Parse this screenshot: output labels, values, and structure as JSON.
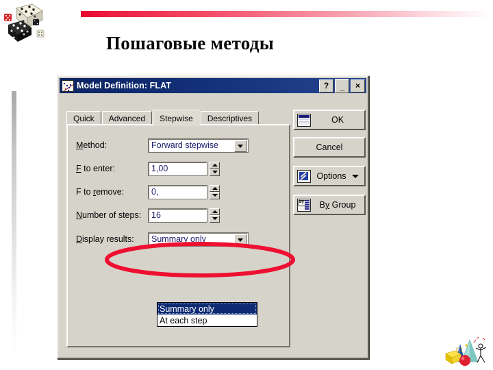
{
  "slide": {
    "title": "Пошаговые методы",
    "decorations": {
      "dice_art": "dice-clipart",
      "corner_art": "3d-shapes-clipart",
      "red_bar": "red-gradient-bar",
      "accent_color": "#e8072e"
    }
  },
  "dialog": {
    "title": "Model Definition: FLAT",
    "title_icon": "scatterplot-icon",
    "titlebar_color": "#0c2461",
    "caption_buttons": [
      {
        "name": "help-button",
        "label": "?"
      },
      {
        "name": "minimize-button",
        "label": "_"
      },
      {
        "name": "close-button",
        "label": "×"
      }
    ],
    "tabs": [
      {
        "label": "Quick",
        "active": false
      },
      {
        "label": "Advanced",
        "active": false
      },
      {
        "label": "Stepwise",
        "active": true
      },
      {
        "label": "Descriptives",
        "active": false
      }
    ],
    "fields": {
      "method": {
        "label_pre": "",
        "label_mnemonic": "M",
        "label_post": "ethod:",
        "value": "Forward stepwise",
        "control": "combobox"
      },
      "f_to_enter": {
        "label_pre": "",
        "label_mnemonic": "F",
        "label_post": " to enter:",
        "value": "1,00",
        "control": "spinner"
      },
      "f_to_remove": {
        "label_pre": "F to ",
        "label_mnemonic": "r",
        "label_post": "emove:",
        "value": "0,",
        "control": "spinner"
      },
      "number_of_steps": {
        "label_pre": "",
        "label_mnemonic": "N",
        "label_post": "umber of steps:",
        "value": "16",
        "control": "spinner"
      },
      "display_results": {
        "label_pre": "",
        "label_mnemonic": "D",
        "label_post": "isplay results:",
        "value": "Summary only",
        "control": "combobox",
        "open": true,
        "options": [
          {
            "label": "Summary only",
            "selected": true
          },
          {
            "label": "At each step",
            "selected": false
          }
        ]
      }
    },
    "buttons": [
      {
        "name": "ok-button",
        "label": "OK",
        "icon": "spreadsheet-icon",
        "dropdown": false
      },
      {
        "name": "cancel-button",
        "label": "Cancel",
        "icon": "",
        "dropdown": false
      },
      {
        "name": "options-button",
        "label": "Options",
        "icon": "tool-icon",
        "dropdown": true
      },
      {
        "name": "by-group-button",
        "label": "By Group",
        "icon": "by-group-icon",
        "dropdown": false,
        "label_pre": "B",
        "label_mnemonic": "y",
        "label_post": " Group"
      }
    ]
  },
  "annotation": {
    "shape": "red-ellipse",
    "color": "#ee1030",
    "targets": "display-results-dropdown"
  }
}
